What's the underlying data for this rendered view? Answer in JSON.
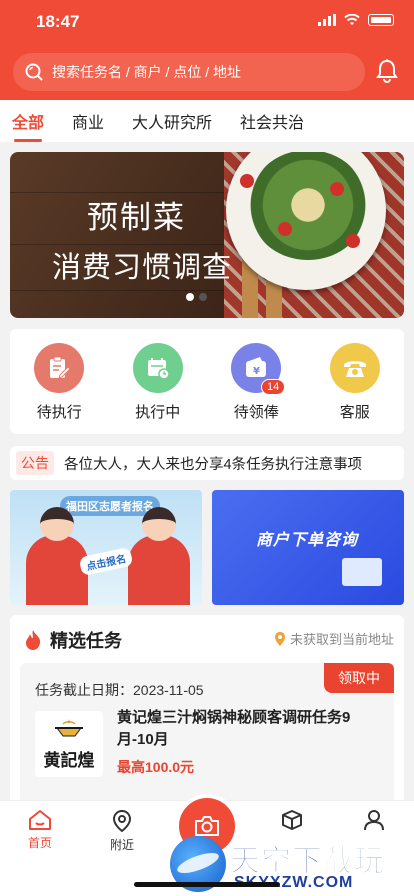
{
  "status_bar": {
    "time": "18:47"
  },
  "search": {
    "placeholder": "搜索任务名 / 商户 / 点位 / 地址"
  },
  "tabs": [
    {
      "label": "全部",
      "active": true
    },
    {
      "label": "商业",
      "active": false
    },
    {
      "label": "大人研究所",
      "active": false
    },
    {
      "label": "社会共治",
      "active": false
    }
  ],
  "banner": {
    "line1": "预制菜",
    "line2": "消费习惯调查",
    "slide_index": 1,
    "slide_count": 2
  },
  "quick_entries": [
    {
      "label": "待执行",
      "icon": "clipboard-edit-icon",
      "color": "#e57a6c"
    },
    {
      "label": "执行中",
      "icon": "calendar-clock-icon",
      "color": "#6fcf8f"
    },
    {
      "label": "待领俸",
      "icon": "wallet-yen-icon",
      "color": "#7a82e8",
      "badge": "14"
    },
    {
      "label": "客服",
      "icon": "phone-icon",
      "color": "#f1c94a"
    }
  ],
  "notice": {
    "tag": "公告",
    "text": "各位大人，大人来也分享4条任务执行注意事项"
  },
  "promos": {
    "left": {
      "tag": "福田区志愿者报名",
      "pill": "点击报名"
    },
    "right": {
      "title": "商户下单咨询"
    }
  },
  "tasks": {
    "title": "精选任务",
    "location": "未获取到当前地址",
    "card": {
      "deadline": "任务截止日期：2023-11-05",
      "status": "领取中",
      "logo_text": "黄記煌",
      "title": "黄记煌三汁焖锅神秘顾客调研任务9月-10月",
      "price": "最高100.0元"
    }
  },
  "bottom_nav": [
    {
      "label": "首页",
      "icon": "home-icon",
      "active": true
    },
    {
      "label": "附近",
      "icon": "location-pin-icon",
      "active": false
    },
    {
      "label": "",
      "icon": "camera-icon",
      "active": false
    },
    {
      "label": "",
      "icon": "box-icon",
      "active": false
    },
    {
      "label": "",
      "icon": "user-icon",
      "active": false
    }
  ],
  "watermark": {
    "main": "天空下载玩",
    "sub": "SKYXZW.COM"
  },
  "colors": {
    "brand": "#ef4b36",
    "accent_red": "#e9442f"
  }
}
